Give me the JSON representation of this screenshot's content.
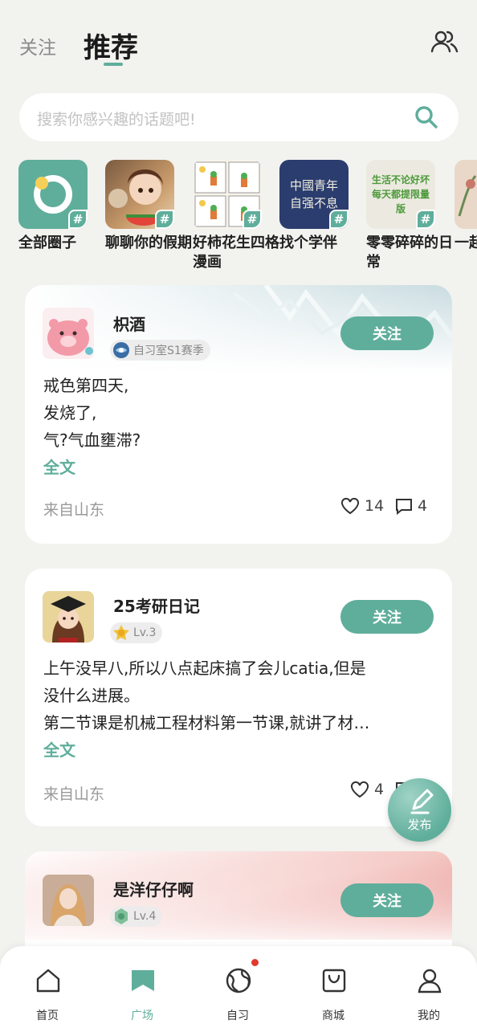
{
  "header": {
    "tab_follow": "关注",
    "tab_recommend": "推荐"
  },
  "search": {
    "placeholder": "搜索你感兴趣的话题吧!"
  },
  "circles": [
    {
      "label": "全部圈子"
    },
    {
      "label": "聊聊你的假期"
    },
    {
      "label": "好柿花生四格漫画"
    },
    {
      "label": "找个学伴",
      "thumb_text": "中國青年 自强不息"
    },
    {
      "label": "零零碎碎的日常",
      "thumb_text": "生活不论好坏 每天都提限量版"
    },
    {
      "label": "一起"
    }
  ],
  "posts": [
    {
      "username": "枳酒",
      "badge": "自习室S1赛季",
      "follow": "关注",
      "lines": [
        "戒色第四天,",
        "发烧了,",
        "气?气血壅滞?"
      ],
      "fulltext": "全文",
      "location": "来自山东",
      "likes": "14",
      "comments": "4"
    },
    {
      "username": "25考研日记",
      "badge": "Lv.3",
      "follow": "关注",
      "lines": [
        "上午没早八,所以八点起床搞了会儿catia,但是",
        "没什么进展。",
        "第二节课是机械工程材料第一节课,就讲了材…"
      ],
      "fulltext": "全文",
      "location": "来自山东",
      "likes": "4",
      "comments": ""
    },
    {
      "username": "是洋仔仔啊",
      "badge": "Lv.4",
      "follow": "关注"
    }
  ],
  "fab": {
    "label": "发布"
  },
  "nav": [
    {
      "label": "首页",
      "icon": "home-icon"
    },
    {
      "label": "广场",
      "icon": "plaza-icon",
      "active": true
    },
    {
      "label": "自习",
      "icon": "globe-icon",
      "dot": true
    },
    {
      "label": "商城",
      "icon": "shopping-bag-icon"
    },
    {
      "label": "我的",
      "icon": "user-icon"
    }
  ],
  "colors": {
    "accent": "#5fae9b",
    "background": "#f2f2ef",
    "notification_dot": "#e0392f"
  }
}
